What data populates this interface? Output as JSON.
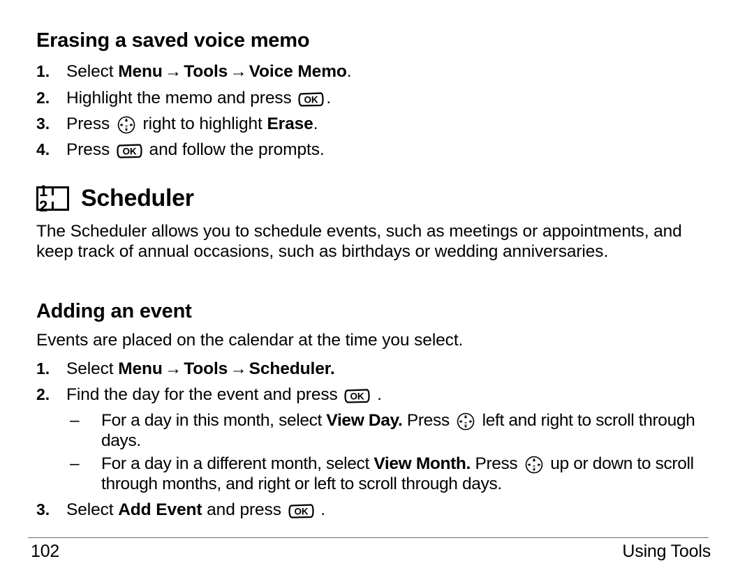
{
  "document": {
    "page_number": "102",
    "footer_chapter": "Using Tools"
  },
  "sections": {
    "erasing": {
      "heading": "Erasing a saved voice memo",
      "steps": [
        {
          "num": "1.",
          "lead": "Select ",
          "b1": "Menu",
          "arrow1": "→",
          "b2": "Tools",
          "arrow2": "→",
          "b3": "Voice Memo",
          "tail": "."
        },
        {
          "num": "2.",
          "lead": "Highlight the memo and press ",
          "icon": "ok-key",
          "tail": "."
        },
        {
          "num": "3.",
          "lead": "Press ",
          "icon": "nav-key",
          "mid": " right to highlight ",
          "b1": "Erase",
          "tail": "."
        },
        {
          "num": "4.",
          "lead": "Press ",
          "icon": "ok-key",
          "tail": " and follow the prompts."
        }
      ]
    },
    "scheduler": {
      "heading": "Scheduler",
      "icon_digits": "1 2",
      "icon_name": "calendar-book-icon",
      "paragraph": "The Scheduler allows you to schedule events, such as meetings or appointments, and keep track of annual occasions, such as birthdays or wedding anniversaries."
    },
    "adding_event": {
      "heading": "Adding an event",
      "paragraph": "Events are placed on the calendar at the time you select.",
      "steps": [
        {
          "num": "1.",
          "lead": "Select ",
          "b1": "Menu",
          "arrow1": "→",
          "b2": "Tools",
          "arrow2": "→",
          "b3": "Scheduler.",
          "tail": ""
        },
        {
          "num": "2.",
          "lead": "Find the day for the event and press ",
          "icon": "ok-key",
          "tail": " ."
        }
      ],
      "sub_bullets": [
        {
          "dash": "–",
          "lead": "For a day in this month, select ",
          "b1": "View Day.",
          "mid": " Press ",
          "icon": "nav-key",
          "tail": " left and right to scroll through days."
        },
        {
          "dash": "–",
          "lead": "For a day in a different month, select ",
          "b1": "View Month.",
          "mid": " Press ",
          "icon": "nav-key",
          "tail": " up or down to scroll through months, and right or left to scroll through days."
        }
      ],
      "final_step": {
        "num": "3.",
        "lead": "Select ",
        "b1": "Add Event",
        "mid": " and press ",
        "icon": "ok-key",
        "tail": " ."
      }
    }
  }
}
